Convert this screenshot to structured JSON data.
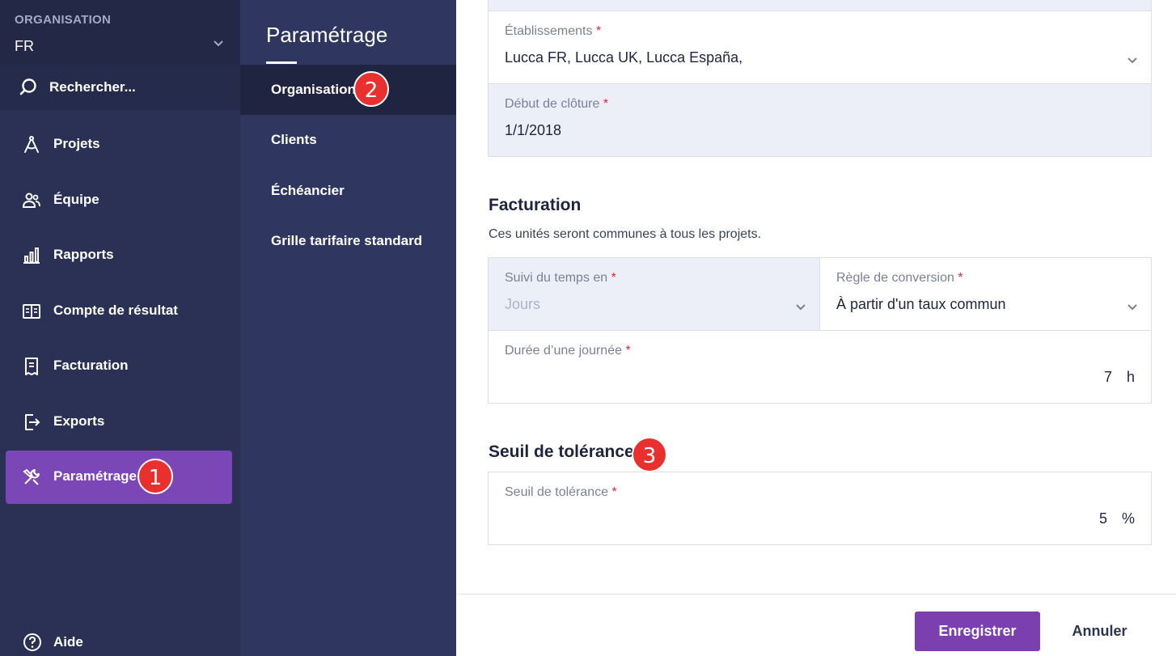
{
  "sidebar": {
    "org_label": "ORGANISATION",
    "org_value": "FR",
    "search_label": "Rechercher...",
    "items": [
      {
        "label": "Projets",
        "icon": "compass-icon"
      },
      {
        "label": "Équipe",
        "icon": "users-icon"
      },
      {
        "label": "Rapports",
        "icon": "bar-chart-icon"
      },
      {
        "label": "Compte de résultat",
        "icon": "book-icon"
      },
      {
        "label": "Facturation",
        "icon": "receipt-icon"
      },
      {
        "label": "Exports",
        "icon": "export-icon"
      },
      {
        "label": "Paramétrage",
        "icon": "tools-icon",
        "active": true
      }
    ],
    "help_label": "Aide"
  },
  "subnav": {
    "title": "Paramétrage",
    "items": [
      {
        "label": "Organisation",
        "active": true
      },
      {
        "label": "Clients"
      },
      {
        "label": "Échéancier"
      },
      {
        "label": "Grille tarifaire standard"
      }
    ]
  },
  "badges": [
    "1",
    "2",
    "3"
  ],
  "main": {
    "etablissements": {
      "label": "Établissements",
      "required": "*",
      "value": "Lucca FR, Lucca UK, Lucca España,"
    },
    "cloture": {
      "label": "Début de clôture",
      "required": "*",
      "value": "1/1/2018"
    },
    "facturation": {
      "title": "Facturation",
      "description": "Ces unités seront communes à tous les projets.",
      "suivi": {
        "label": "Suivi du temps en",
        "required": "*",
        "value": "Jours"
      },
      "regle": {
        "label": "Règle de conversion",
        "required": "*",
        "value": "À partir d'un taux commun"
      },
      "duree": {
        "label": "Durée d’une journée",
        "required": "*",
        "value": "7",
        "unit": "h"
      }
    },
    "seuil": {
      "title": "Seuil de tolérance",
      "field": {
        "label": "Seuil de tolérance",
        "required": "*",
        "value": "5",
        "unit": "%"
      }
    }
  },
  "footer": {
    "save_label": "Enregistrer",
    "cancel_label": "Annuler"
  },
  "colors": {
    "sidebar": "#2a3155",
    "subnav": "#2f3760",
    "accent": "#7b46b5",
    "badge": "#e8312f",
    "required": "#e0263b"
  }
}
